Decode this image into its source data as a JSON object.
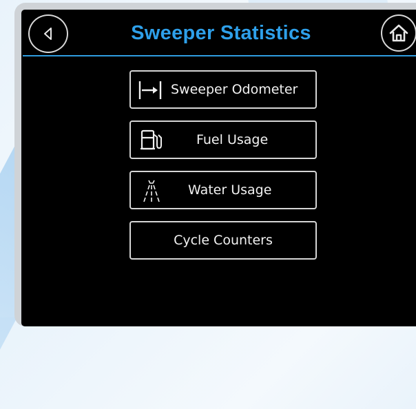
{
  "header": {
    "title": "Sweeper Statistics",
    "back_icon": "back-arrow-icon",
    "home_icon": "home-icon"
  },
  "menu": {
    "items": [
      {
        "label": "Sweeper Odometer",
        "icon": "odometer-icon"
      },
      {
        "label": "Fuel Usage",
        "icon": "fuel-pump-icon"
      },
      {
        "label": "Water Usage",
        "icon": "water-spray-icon"
      },
      {
        "label": "Cycle Counters",
        "icon": ""
      }
    ]
  },
  "colors": {
    "accent": "#2ea0ea",
    "screen_background": "#000000",
    "button_border": "#d6d6d6",
    "text": "#f2f2f2"
  }
}
